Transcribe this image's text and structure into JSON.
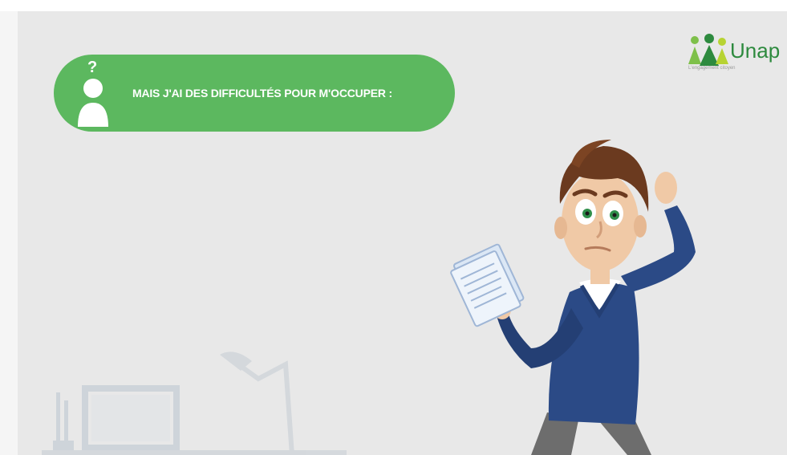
{
  "banner": {
    "icon": "person-question-icon",
    "question_mark": "?",
    "text": "MAIS J'AI DES DIFFICULTÉS POUR M'OCCUPER :"
  },
  "logo": {
    "icon": "unapei-figures-icon",
    "text": "Unap",
    "tagline": "L'engagement citoyen"
  },
  "colors": {
    "banner_green": "#5cb85f",
    "slide_background": "#e8e8e8",
    "logo_green": "#2d8a3e",
    "sweater_blue": "#2b4a86"
  }
}
